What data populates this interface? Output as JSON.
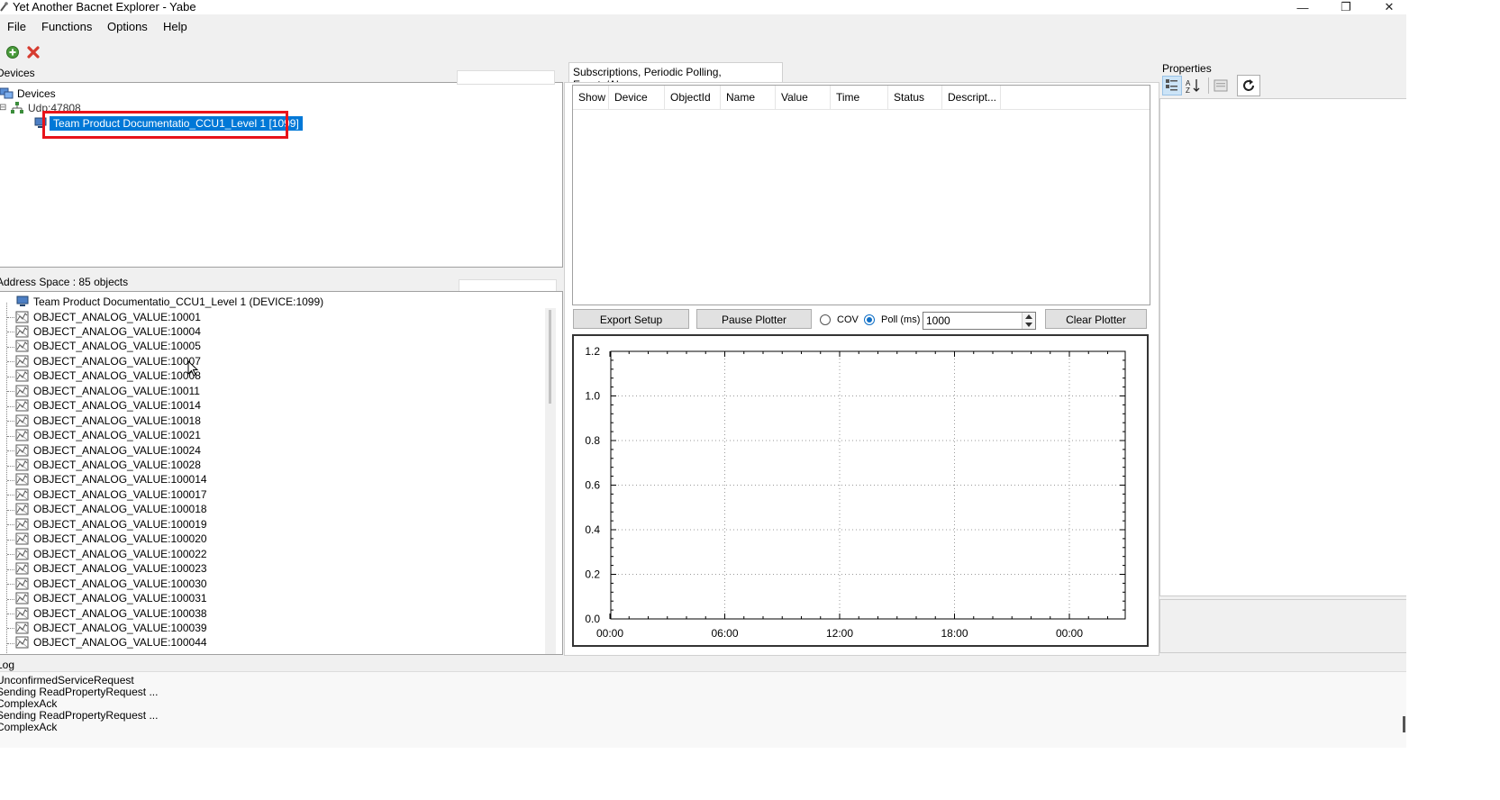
{
  "window": {
    "title": "Yet Another Bacnet Explorer - Yabe",
    "minimize": "—",
    "restore": "❐",
    "close": "✕"
  },
  "menu": [
    "File",
    "Functions",
    "Options",
    "Help"
  ],
  "toolbar": {
    "add_icon": "add-icon",
    "remove_icon": "remove-icon"
  },
  "devices": {
    "label": "Devices",
    "root": "Devices",
    "transport": "Udp:47808",
    "selected_device": "Team Product Documentatio_CCU1_Level 1 [1099]"
  },
  "address_space": {
    "label": "Address Space : 85 objects",
    "root": "Team Product Documentatio_CCU1_Level 1 (DEVICE:1099)",
    "objects": [
      "OBJECT_ANALOG_VALUE:10001",
      "OBJECT_ANALOG_VALUE:10004",
      "OBJECT_ANALOG_VALUE:10005",
      "OBJECT_ANALOG_VALUE:10007",
      "OBJECT_ANALOG_VALUE:10008",
      "OBJECT_ANALOG_VALUE:10011",
      "OBJECT_ANALOG_VALUE:10014",
      "OBJECT_ANALOG_VALUE:10018",
      "OBJECT_ANALOG_VALUE:10021",
      "OBJECT_ANALOG_VALUE:10024",
      "OBJECT_ANALOG_VALUE:10028",
      "OBJECT_ANALOG_VALUE:100014",
      "OBJECT_ANALOG_VALUE:100017",
      "OBJECT_ANALOG_VALUE:100018",
      "OBJECT_ANALOG_VALUE:100019",
      "OBJECT_ANALOG_VALUE:100020",
      "OBJECT_ANALOG_VALUE:100022",
      "OBJECT_ANALOG_VALUE:100023",
      "OBJECT_ANALOG_VALUE:100030",
      "OBJECT_ANALOG_VALUE:100031",
      "OBJECT_ANALOG_VALUE:100038",
      "OBJECT_ANALOG_VALUE:100039",
      "OBJECT_ANALOG_VALUE:100044"
    ]
  },
  "subscriptions": {
    "tab": "Subscriptions, Periodic Polling, Events/Alarms",
    "columns": [
      "Show",
      "Device",
      "ObjectId",
      "Name",
      "Value",
      "Time",
      "Status",
      "Descript..."
    ]
  },
  "plotter": {
    "export_label": "Export Setup",
    "pause_label": "Pause Plotter",
    "cov_label": "COV",
    "poll_label": "Poll (ms)",
    "poll_value": "1000",
    "clear_label": "Clear Plotter",
    "mode": "poll"
  },
  "chart_data": {
    "type": "line",
    "x_ticks": [
      "00:00",
      "06:00",
      "12:00",
      "18:00",
      "00:00"
    ],
    "y_ticks": [
      "0.0",
      "0.2",
      "0.4",
      "0.6",
      "0.8",
      "1.0",
      "1.2"
    ],
    "ylim": [
      0,
      1.2
    ],
    "grid": true,
    "series": []
  },
  "properties": {
    "label": "Properties",
    "categorized_icon": "categorized-icon",
    "alphabetical_icon": "sort-az-icon",
    "pages_icon": "property-pages-icon",
    "refresh_icon": "refresh-icon"
  },
  "log": {
    "label": "Log",
    "lines": [
      "UnconfirmedServiceRequest",
      "Sending ReadPropertyRequest ...",
      "ComplexAck",
      "Sending ReadPropertyRequest ...",
      "ComplexAck"
    ]
  }
}
